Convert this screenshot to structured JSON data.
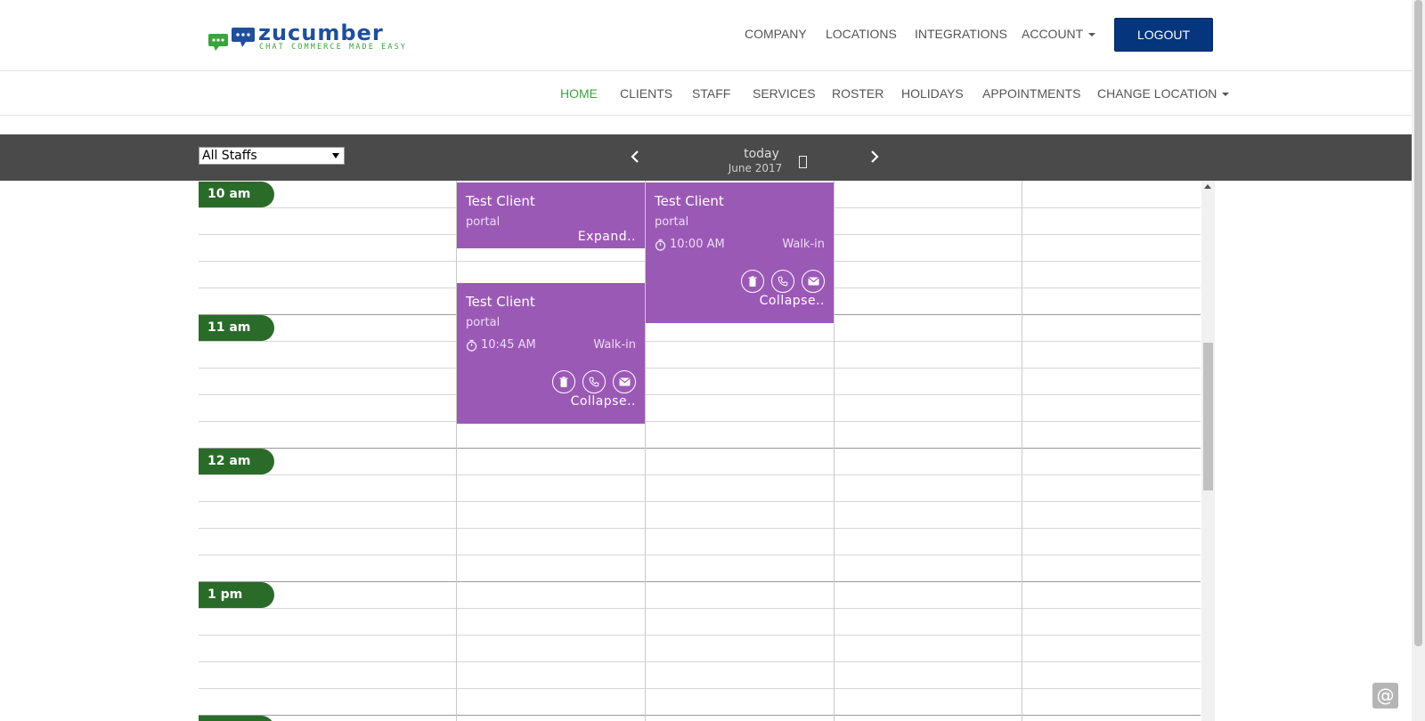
{
  "brand": {
    "name": "Zucumber",
    "wordmark": "zucumber",
    "tagline": "CHAT COMMERCE MADE EASY",
    "colors": {
      "blue": "#1f4f9a",
      "green": "#3aa53d"
    }
  },
  "top_nav": {
    "items": [
      "COMPANY",
      "LOCATIONS",
      "INTEGRATIONS",
      "ACCOUNT"
    ],
    "logout_label": "LOGOUT"
  },
  "sub_nav": {
    "items": [
      "HOME",
      "CLIENTS",
      "STAFF",
      "SERVICES",
      "ROSTER",
      "HOLIDAYS",
      "APPOINTMENTS",
      "CHANGE LOCATION"
    ],
    "active": "HOME"
  },
  "toolbar": {
    "staff_select": "All Staffs",
    "today_label": "today",
    "month_label": "June 2017",
    "icons": [
      "chevron-left-icon",
      "calendar-icon",
      "chevron-right-icon"
    ]
  },
  "calendar": {
    "time_labels": [
      "10 am",
      "11 am",
      "12 am",
      "1 pm"
    ],
    "pill_color": "#2a6b2a",
    "appointment_color": "#9b59b6",
    "appointments": [
      {
        "client": "Test Client",
        "source": "portal",
        "toggle": "Expand.."
      },
      {
        "client": "Test Client",
        "source": "portal",
        "time": "10:00 AM",
        "type": "Walk-in",
        "toggle": "Collapse.."
      },
      {
        "client": "Test Client",
        "source": "portal",
        "time": "10:45 AM",
        "type": "Walk-in",
        "toggle": "Collapse.."
      }
    ]
  },
  "widget": {
    "label": "@"
  }
}
